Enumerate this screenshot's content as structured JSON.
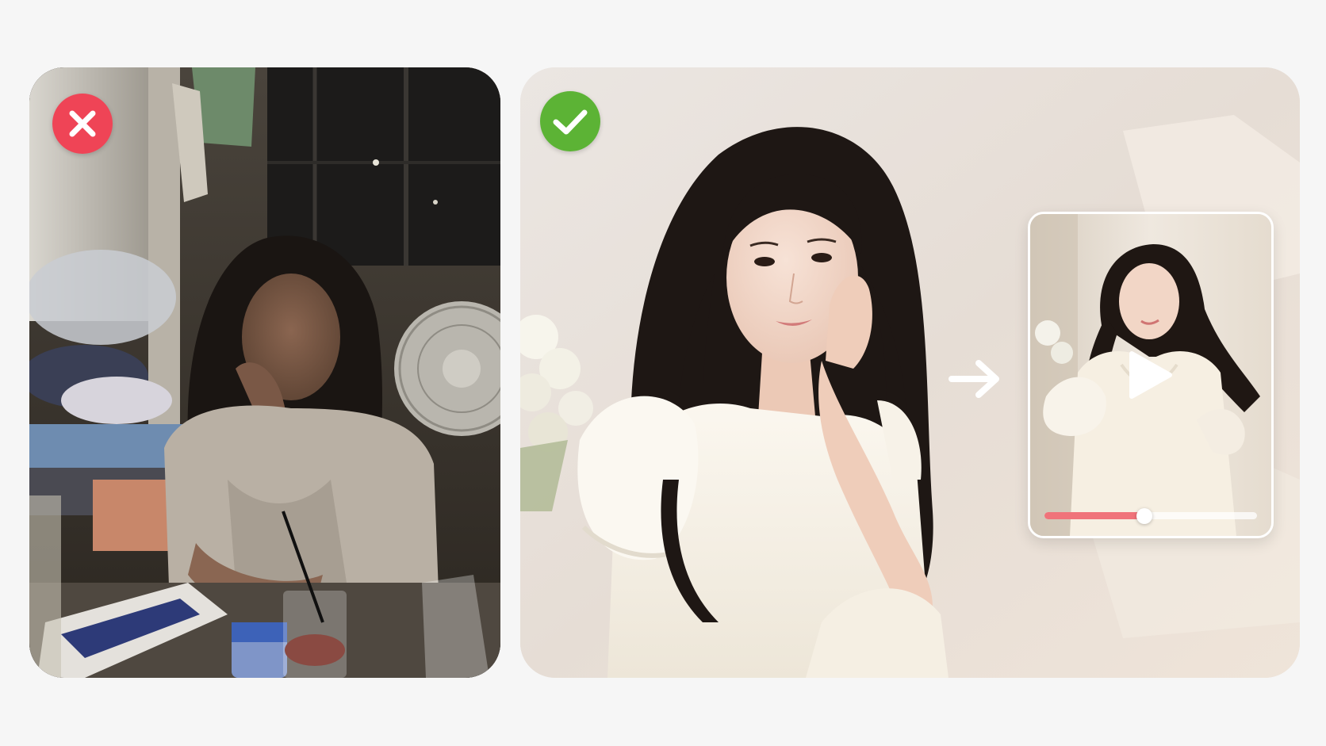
{
  "comparison": {
    "bad": {
      "icon": "x-icon",
      "badge_color": "#ef4456"
    },
    "good": {
      "icon": "check-icon",
      "badge_color": "#5cb335"
    }
  },
  "video_preview": {
    "play_icon": "play-icon",
    "progress": 0.47,
    "progress_color": "#f0737a"
  },
  "arrow_icon": "arrow-right-icon"
}
